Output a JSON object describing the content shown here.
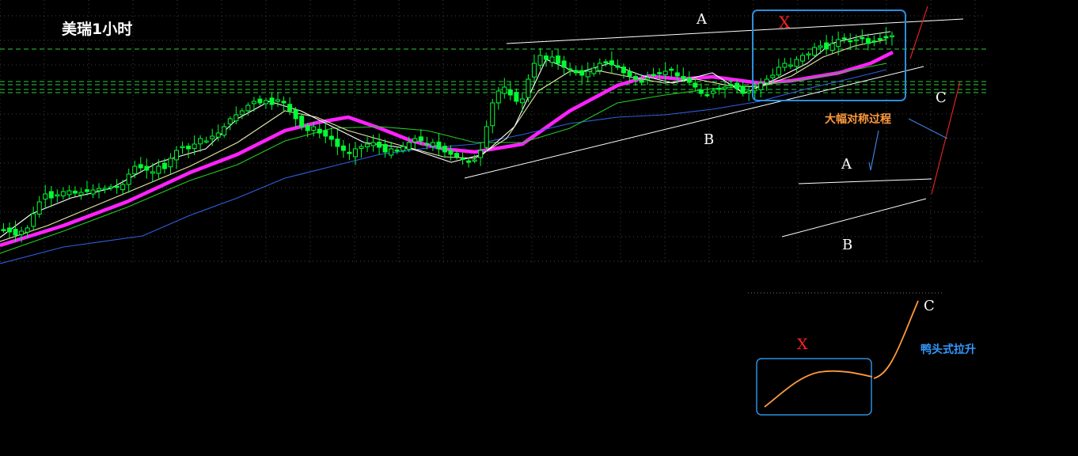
{
  "title": "美瑞1小时",
  "labels": {
    "upper_a": "A",
    "upper_x": "X",
    "upper_b": "B",
    "upper_c": "C",
    "right_process": "大幅对称过程",
    "right_a": "A",
    "right_b": "B",
    "inset_x": "X",
    "inset_c": "C",
    "inset_note": "鸭头式拉升"
  },
  "colors": {
    "background": "#000000",
    "grid": "#5a5a5a",
    "hline": "#2ecc40",
    "ma_main": "#ff22ff",
    "ma_long": "#2f5fe0",
    "ma_mid": "#22c922",
    "ma_short": "#e8e8a8",
    "ma_fast": "#ffffff",
    "candle": "#00ff33",
    "trendline": "#ffffff",
    "red_line": "#dd2222",
    "box": "#2a8fe0",
    "orange": "#ff9a3c",
    "label_white": "#ffffff",
    "label_red": "#ff2222",
    "label_blue": "#3399ff"
  },
  "chart_data": {
    "type": "candlestick",
    "title": "美瑞1小时",
    "xlabel": "",
    "ylabel": "",
    "grid": true,
    "close_series": [
      290,
      293,
      297,
      292,
      288,
      270,
      255,
      245,
      250,
      246,
      242,
      241,
      244,
      243,
      242,
      240,
      238,
      238,
      236,
      236,
      233,
      220,
      210,
      212,
      215,
      217,
      210,
      213,
      200,
      190,
      185,
      188,
      182,
      175,
      178,
      172,
      168,
      160,
      150,
      145,
      140,
      133,
      128,
      130,
      127,
      132,
      126,
      130,
      140,
      150,
      160,
      165,
      160,
      168,
      172,
      176,
      185,
      190,
      194,
      188,
      185,
      182,
      180,
      186,
      192,
      188,
      190,
      185,
      180,
      175,
      178,
      182,
      180,
      188,
      192,
      195,
      198,
      200,
      205,
      202,
      190,
      160,
      130,
      115,
      110,
      120,
      128,
      125,
      100,
      80,
      70,
      75,
      72,
      80,
      85,
      88,
      92,
      95,
      90,
      86,
      80,
      78,
      82,
      85,
      92,
      96,
      100,
      104,
      98,
      95,
      93,
      90,
      88,
      96,
      100,
      104,
      110,
      118,
      120,
      115,
      112,
      110,
      108,
      112,
      118,
      115,
      112,
      105,
      100,
      95,
      85,
      80,
      82,
      75,
      70,
      68,
      60,
      58,
      62,
      55,
      50,
      48,
      52,
      50,
      48,
      55,
      52,
      50,
      48,
      45
    ],
    "hlines": [
      62,
      103,
      107,
      113,
      117
    ],
    "moving_averages": [
      {
        "color": "#ff22ff",
        "points": [
          [
            0,
            310
          ],
          [
            80,
            285
          ],
          [
            160,
            255
          ],
          [
            240,
            218
          ],
          [
            300,
            195
          ],
          [
            360,
            165
          ],
          [
            400,
            155
          ],
          [
            440,
            148
          ],
          [
            480,
            162
          ],
          [
            520,
            178
          ],
          [
            560,
            188
          ],
          [
            600,
            192
          ],
          [
            660,
            182
          ],
          [
            720,
            140
          ],
          [
            780,
            108
          ],
          [
            820,
            96
          ],
          [
            860,
            100
          ],
          [
            900,
            97
          ],
          [
            960,
            105
          ],
          [
            1000,
            102
          ],
          [
            1060,
            92
          ],
          [
            1100,
            80
          ],
          [
            1128,
            66
          ]
        ]
      },
      {
        "color": "#2f5fe0",
        "points": [
          [
            0,
            333
          ],
          [
            80,
            312
          ],
          [
            180,
            298
          ],
          [
            240,
            272
          ],
          [
            300,
            250
          ],
          [
            360,
            225
          ],
          [
            420,
            210
          ],
          [
            480,
            195
          ],
          [
            540,
            187
          ],
          [
            600,
            182
          ],
          [
            660,
            170
          ],
          [
            720,
            156
          ],
          [
            780,
            148
          ],
          [
            840,
            145
          ],
          [
            900,
            138
          ],
          [
            960,
            128
          ],
          [
            1020,
            112
          ],
          [
            1080,
            98
          ],
          [
            1120,
            88
          ]
        ]
      },
      {
        "color": "#22c922",
        "points": [
          [
            0,
            320
          ],
          [
            80,
            292
          ],
          [
            160,
            262
          ],
          [
            240,
            228
          ],
          [
            300,
            208
          ],
          [
            360,
            178
          ],
          [
            420,
            162
          ],
          [
            480,
            160
          ],
          [
            540,
            165
          ],
          [
            600,
            180
          ],
          [
            660,
            180
          ],
          [
            720,
            162
          ],
          [
            780,
            130
          ],
          [
            840,
            120
          ],
          [
            900,
            112
          ],
          [
            960,
            108
          ],
          [
            1020,
            100
          ],
          [
            1080,
            88
          ],
          [
            1120,
            80
          ]
        ]
      },
      {
        "color": "#e8e8a8",
        "points": [
          [
            0,
            305
          ],
          [
            60,
            285
          ],
          [
            120,
            260
          ],
          [
            180,
            235
          ],
          [
            240,
            210
          ],
          [
            300,
            180
          ],
          [
            360,
            140
          ],
          [
            400,
            148
          ],
          [
            440,
            165
          ],
          [
            500,
            182
          ],
          [
            560,
            198
          ],
          [
            600,
            200
          ],
          [
            640,
            175
          ],
          [
            680,
            115
          ],
          [
            720,
            90
          ],
          [
            760,
            90
          ],
          [
            800,
            98
          ],
          [
            840,
            105
          ],
          [
            880,
            100
          ],
          [
            920,
            108
          ],
          [
            960,
            110
          ],
          [
            1000,
            96
          ],
          [
            1040,
            72
          ],
          [
            1080,
            58
          ],
          [
            1120,
            50
          ]
        ]
      },
      {
        "color": "#ffffff",
        "points": [
          [
            0,
            300
          ],
          [
            40,
            270
          ],
          [
            90,
            250
          ],
          [
            140,
            238
          ],
          [
            200,
            205
          ],
          [
            260,
            188
          ],
          [
            300,
            150
          ],
          [
            340,
            128
          ],
          [
            380,
            140
          ],
          [
            420,
            160
          ],
          [
            460,
            180
          ],
          [
            520,
            188
          ],
          [
            570,
            205
          ],
          [
            610,
            195
          ],
          [
            650,
            160
          ],
          [
            690,
            75
          ],
          [
            730,
            92
          ],
          [
            770,
            80
          ],
          [
            810,
            95
          ],
          [
            850,
            105
          ],
          [
            900,
            92
          ],
          [
            940,
            118
          ],
          [
            980,
            100
          ],
          [
            1020,
            80
          ],
          [
            1050,
            55
          ],
          [
            1090,
            45
          ],
          [
            1125,
            40
          ]
        ]
      }
    ],
    "annotations": [
      "A",
      "X",
      "B",
      "C",
      "大幅对称过程",
      "A",
      "B",
      "X",
      "C",
      "鸭头式拉升"
    ]
  }
}
